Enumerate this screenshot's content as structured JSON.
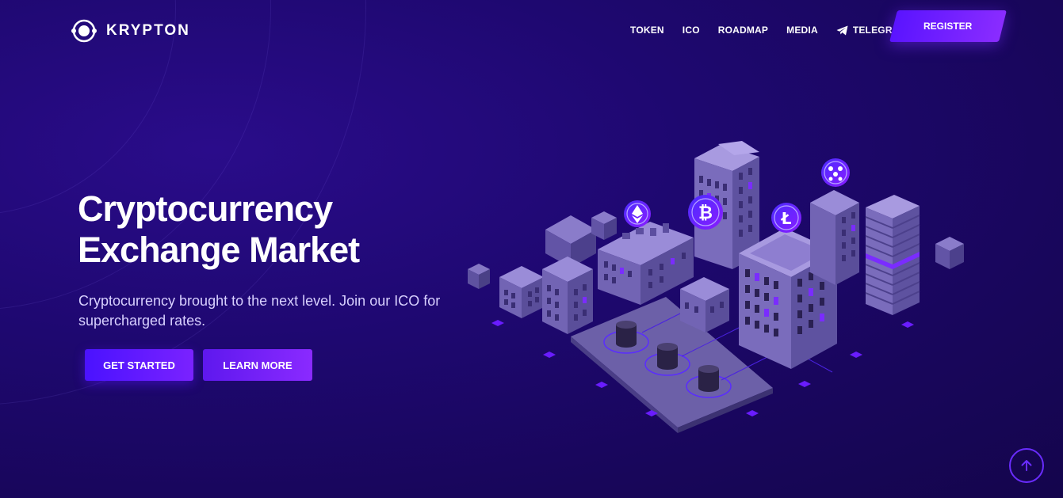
{
  "brand": {
    "name": "KRYPTON"
  },
  "nav": {
    "items": [
      {
        "label": "TOKEN"
      },
      {
        "label": "ICO"
      },
      {
        "label": "ROADMAP"
      },
      {
        "label": "MEDIA"
      },
      {
        "label": "TELEGRAM",
        "icon": "telegram-icon"
      }
    ],
    "register_label": "REGISTER"
  },
  "hero": {
    "title_line1": "Cryptocurrency",
    "title_line2": "Exchange Market",
    "subtitle": "Cryptocurrency brought to the next level. Join our ICO for supercharged rates.",
    "primary_button": "GET STARTED",
    "secondary_button": "LEARN MORE"
  },
  "illustration": {
    "coins": [
      "ethereum-icon",
      "bitcoin-icon",
      "litecoin-icon",
      "ripple-icon"
    ]
  },
  "scroll_top": {
    "icon": "arrow-up-icon"
  },
  "colors": {
    "background": "#1e0870",
    "accent": "#6a1cff",
    "accent_light": "#8a2cff",
    "building": "#7a6ab0"
  }
}
